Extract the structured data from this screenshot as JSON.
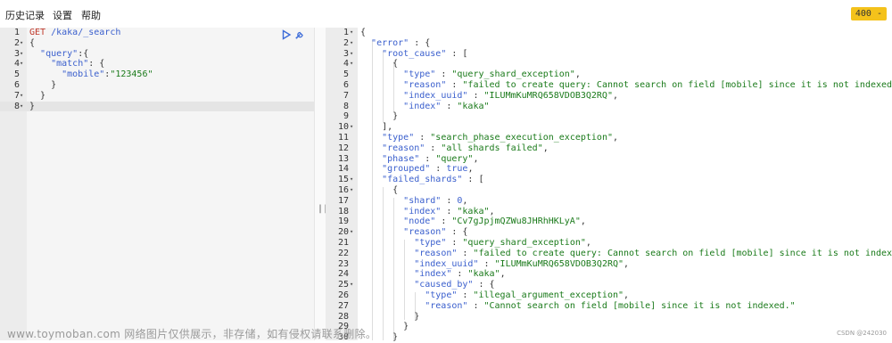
{
  "menubar": {
    "items": [
      "历史记录",
      "设置",
      "帮助"
    ],
    "status": "400 -"
  },
  "request": {
    "lines": [
      {
        "n": "1",
        "fold": "",
        "t": [
          [
            "m",
            "GET "
          ],
          [
            "k",
            "/kaka/_search"
          ]
        ]
      },
      {
        "n": "2",
        "fold": "▾",
        "t": [
          [
            "p",
            "{"
          ]
        ]
      },
      {
        "n": "3",
        "fold": "▾",
        "t": [
          [
            "p",
            "  "
          ],
          [
            "k",
            "\"query\""
          ],
          [
            "p",
            ":{"
          ]
        ]
      },
      {
        "n": "4",
        "fold": "▾",
        "t": [
          [
            "p",
            "    "
          ],
          [
            "k",
            "\"match\""
          ],
          [
            "p",
            ": {"
          ]
        ]
      },
      {
        "n": "5",
        "fold": "",
        "t": [
          [
            "p",
            "      "
          ],
          [
            "k",
            "\"mobile\""
          ],
          [
            "p",
            ":"
          ],
          [
            "s",
            "\"123456\""
          ]
        ]
      },
      {
        "n": "6",
        "fold": "",
        "t": [
          [
            "p",
            "    }"
          ]
        ]
      },
      {
        "n": "7",
        "fold": "▾",
        "t": [
          [
            "p",
            "  }"
          ]
        ]
      },
      {
        "n": "8",
        "fold": "▾",
        "t": [
          [
            "p",
            "}"
          ]
        ]
      }
    ],
    "active_line": 7
  },
  "response": {
    "lines": [
      {
        "n": "1",
        "fold": "▾",
        "t": [
          [
            "p",
            "{"
          ]
        ]
      },
      {
        "n": "2",
        "fold": "▾",
        "t": [
          [
            "p",
            "  "
          ],
          [
            "k",
            "\"error\""
          ],
          [
            "p",
            " : {"
          ]
        ]
      },
      {
        "n": "3",
        "fold": "▾",
        "t": [
          [
            "p",
            "    "
          ],
          [
            "k",
            "\"root_cause\""
          ],
          [
            "p",
            " : ["
          ]
        ]
      },
      {
        "n": "4",
        "fold": "▾",
        "t": [
          [
            "p",
            "      {"
          ]
        ]
      },
      {
        "n": "5",
        "fold": "",
        "t": [
          [
            "p",
            "        "
          ],
          [
            "k",
            "\"type\""
          ],
          [
            "p",
            " : "
          ],
          [
            "s",
            "\"query_shard_exception\""
          ],
          [
            "p",
            ","
          ]
        ]
      },
      {
        "n": "6",
        "fold": "",
        "t": [
          [
            "p",
            "        "
          ],
          [
            "k",
            "\"reason\""
          ],
          [
            "p",
            " : "
          ],
          [
            "s",
            "\"failed to create query: Cannot search on field [mobile] since it is not indexed.\""
          ],
          [
            "p",
            ","
          ]
        ]
      },
      {
        "n": "7",
        "fold": "",
        "t": [
          [
            "p",
            "        "
          ],
          [
            "k",
            "\"index_uuid\""
          ],
          [
            "p",
            " : "
          ],
          [
            "s",
            "\"ILUMmKuMRQ658VDOB3Q2RQ\""
          ],
          [
            "p",
            ","
          ]
        ]
      },
      {
        "n": "8",
        "fold": "",
        "t": [
          [
            "p",
            "        "
          ],
          [
            "k",
            "\"index\""
          ],
          [
            "p",
            " : "
          ],
          [
            "s",
            "\"kaka\""
          ]
        ]
      },
      {
        "n": "9",
        "fold": "",
        "t": [
          [
            "p",
            "      }"
          ]
        ]
      },
      {
        "n": "10",
        "fold": "▾",
        "t": [
          [
            "p",
            "    ],"
          ]
        ]
      },
      {
        "n": "11",
        "fold": "",
        "t": [
          [
            "p",
            "    "
          ],
          [
            "k",
            "\"type\""
          ],
          [
            "p",
            " : "
          ],
          [
            "s",
            "\"search_phase_execution_exception\""
          ],
          [
            "p",
            ","
          ]
        ]
      },
      {
        "n": "12",
        "fold": "",
        "t": [
          [
            "p",
            "    "
          ],
          [
            "k",
            "\"reason\""
          ],
          [
            "p",
            " : "
          ],
          [
            "s",
            "\"all shards failed\""
          ],
          [
            "p",
            ","
          ]
        ]
      },
      {
        "n": "13",
        "fold": "",
        "t": [
          [
            "p",
            "    "
          ],
          [
            "k",
            "\"phase\""
          ],
          [
            "p",
            " : "
          ],
          [
            "s",
            "\"query\""
          ],
          [
            "p",
            ","
          ]
        ]
      },
      {
        "n": "14",
        "fold": "",
        "t": [
          [
            "p",
            "    "
          ],
          [
            "k",
            "\"grouped\""
          ],
          [
            "p",
            " : "
          ],
          [
            "k",
            "true"
          ],
          [
            "p",
            ","
          ]
        ]
      },
      {
        "n": "15",
        "fold": "▾",
        "t": [
          [
            "p",
            "    "
          ],
          [
            "k",
            "\"failed_shards\""
          ],
          [
            "p",
            " : ["
          ]
        ]
      },
      {
        "n": "16",
        "fold": "▾",
        "t": [
          [
            "p",
            "      {"
          ]
        ]
      },
      {
        "n": "17",
        "fold": "",
        "t": [
          [
            "p",
            "        "
          ],
          [
            "k",
            "\"shard\""
          ],
          [
            "p",
            " : "
          ],
          [
            "k",
            "0"
          ],
          [
            "p",
            ","
          ]
        ]
      },
      {
        "n": "18",
        "fold": "",
        "t": [
          [
            "p",
            "        "
          ],
          [
            "k",
            "\"index\""
          ],
          [
            "p",
            " : "
          ],
          [
            "s",
            "\"kaka\""
          ],
          [
            "p",
            ","
          ]
        ]
      },
      {
        "n": "19",
        "fold": "",
        "t": [
          [
            "p",
            "        "
          ],
          [
            "k",
            "\"node\""
          ],
          [
            "p",
            " : "
          ],
          [
            "s",
            "\"Cv7gJpjmQZWu8JHRhHKLyA\""
          ],
          [
            "p",
            ","
          ]
        ]
      },
      {
        "n": "20",
        "fold": "▾",
        "t": [
          [
            "p",
            "        "
          ],
          [
            "k",
            "\"reason\""
          ],
          [
            "p",
            " : {"
          ]
        ]
      },
      {
        "n": "21",
        "fold": "",
        "t": [
          [
            "p",
            "          "
          ],
          [
            "k",
            "\"type\""
          ],
          [
            "p",
            " : "
          ],
          [
            "s",
            "\"query_shard_exception\""
          ],
          [
            "p",
            ","
          ]
        ]
      },
      {
        "n": "22",
        "fold": "",
        "t": [
          [
            "p",
            "          "
          ],
          [
            "k",
            "\"reason\""
          ],
          [
            "p",
            " : "
          ],
          [
            "s",
            "\"failed to create query: Cannot search on field [mobile] since it is not indexed.\""
          ],
          [
            "p",
            ","
          ]
        ]
      },
      {
        "n": "23",
        "fold": "",
        "t": [
          [
            "p",
            "          "
          ],
          [
            "k",
            "\"index_uuid\""
          ],
          [
            "p",
            " : "
          ],
          [
            "s",
            "\"ILUMmKuMRQ658VDOB3Q2RQ\""
          ],
          [
            "p",
            ","
          ]
        ]
      },
      {
        "n": "24",
        "fold": "",
        "t": [
          [
            "p",
            "          "
          ],
          [
            "k",
            "\"index\""
          ],
          [
            "p",
            " : "
          ],
          [
            "s",
            "\"kaka\""
          ],
          [
            "p",
            ","
          ]
        ]
      },
      {
        "n": "25",
        "fold": "▾",
        "t": [
          [
            "p",
            "          "
          ],
          [
            "k",
            "\"caused_by\""
          ],
          [
            "p",
            " : {"
          ]
        ]
      },
      {
        "n": "26",
        "fold": "",
        "t": [
          [
            "p",
            "            "
          ],
          [
            "k",
            "\"type\""
          ],
          [
            "p",
            " : "
          ],
          [
            "s",
            "\"illegal_argument_exception\""
          ],
          [
            "p",
            ","
          ]
        ]
      },
      {
        "n": "27",
        "fold": "",
        "t": [
          [
            "p",
            "            "
          ],
          [
            "k",
            "\"reason\""
          ],
          [
            "p",
            " : "
          ],
          [
            "s",
            "\"Cannot search on field [mobile] since it is not indexed.\""
          ]
        ]
      },
      {
        "n": "28",
        "fold": "",
        "t": [
          [
            "p",
            "          }"
          ]
        ]
      },
      {
        "n": "29",
        "fold": "",
        "t": [
          [
            "p",
            "        }"
          ]
        ]
      },
      {
        "n": "30",
        "fold": "",
        "t": [
          [
            "p",
            "      }"
          ]
        ]
      }
    ]
  },
  "divider": {
    "handle": "||"
  },
  "watermark": "www.toymoban.com 网络图片仅供展示，非存储，如有侵权请联系删除。",
  "credit": "CSDN @242030",
  "icons": {
    "run": "play-icon",
    "settings": "wrench-icon"
  },
  "colors": {
    "key": "#3a5fcd",
    "string": "#1a7a1a",
    "method": "#c0392b",
    "badge": "#f4c21b"
  }
}
